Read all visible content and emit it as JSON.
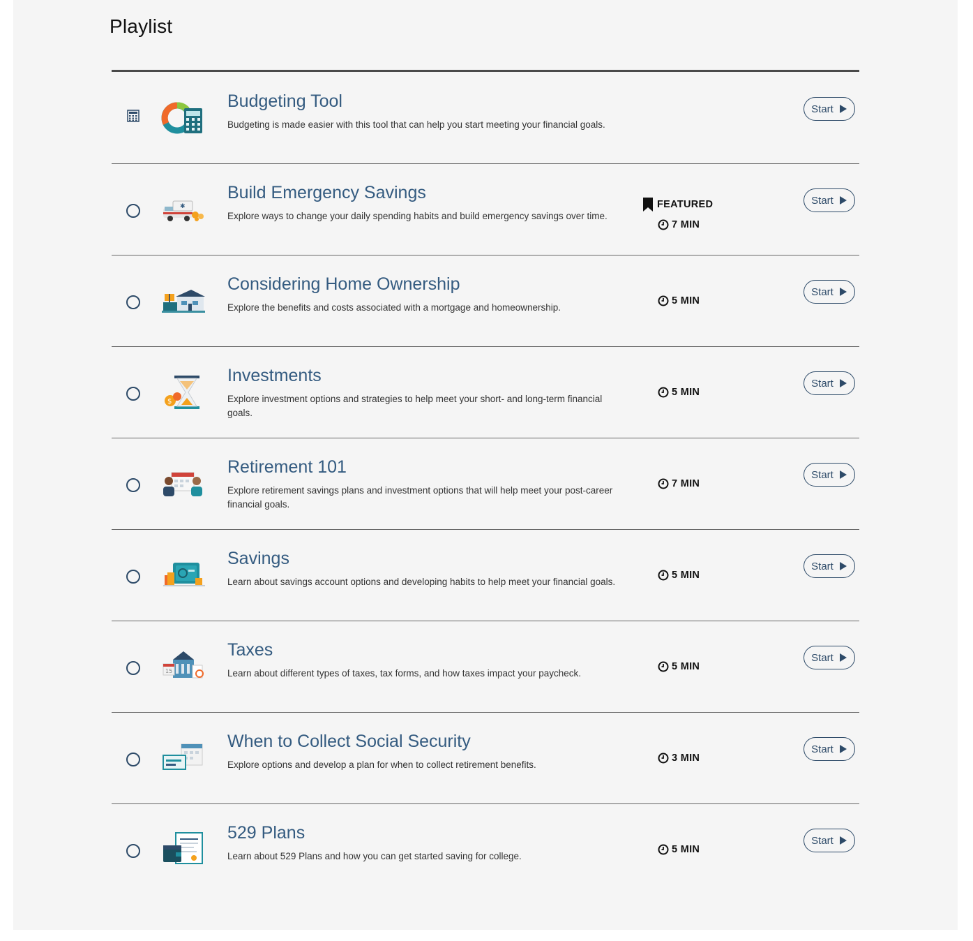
{
  "page": {
    "title": "Playlist"
  },
  "featured_label": "FEATURED",
  "items": [
    {
      "title": "Budgeting Tool",
      "description": "Budgeting is made easier with this tool that can help you start meeting your financial goals.",
      "duration": "",
      "featured": false,
      "status_icon": "calculator-icon",
      "thumbnail": "budget-chart-calculator-illustration",
      "start_label": "Start"
    },
    {
      "title": "Build Emergency Savings",
      "description": "Explore ways to change your daily spending habits and build emergency savings over time.",
      "duration": "7 MIN",
      "featured": true,
      "status_icon": "circle-icon",
      "thumbnail": "ambulance-coins-illustration",
      "start_label": "Start"
    },
    {
      "title": "Considering Home Ownership",
      "description": "Explore the benefits and costs associated with a mortgage and homeownership.",
      "duration": "5 MIN",
      "featured": false,
      "status_icon": "circle-icon",
      "thumbnail": "house-sale-illustration",
      "start_label": "Start"
    },
    {
      "title": "Investments",
      "description": "Explore investment options and strategies to help meet your short- and long-term financial goals.",
      "duration": "5 MIN",
      "featured": false,
      "status_icon": "circle-icon",
      "thumbnail": "hourglass-coins-illustration",
      "start_label": "Start"
    },
    {
      "title": "Retirement 101",
      "description": "Explore retirement savings plans and investment options that will help meet your post-career financial goals.",
      "duration": "7 MIN",
      "featured": false,
      "status_icon": "circle-icon",
      "thumbnail": "couple-calendar-illustration",
      "start_label": "Start"
    },
    {
      "title": "Savings",
      "description": "Learn about savings account options and developing habits to help meet your financial goals.",
      "duration": "5 MIN",
      "featured": false,
      "status_icon": "circle-icon",
      "thumbnail": "safe-coins-illustration",
      "start_label": "Start"
    },
    {
      "title": "Taxes",
      "description": "Learn about different types of taxes, tax forms, and how taxes impact your paycheck.",
      "duration": "5 MIN",
      "featured": false,
      "status_icon": "circle-icon",
      "thumbnail": "building-calendar-illustration",
      "start_label": "Start"
    },
    {
      "title": "When to Collect Social Security",
      "description": "Explore options and develop a plan for when to collect retirement benefits.",
      "duration": "3 MIN",
      "featured": false,
      "status_icon": "circle-icon",
      "thumbnail": "social-security-card-calendar-illustration",
      "start_label": "Start"
    },
    {
      "title": "529 Plans",
      "description": "Learn about 529 Plans and how you can get started saving for college.",
      "duration": "5 MIN",
      "featured": false,
      "status_icon": "circle-icon",
      "thumbnail": "diploma-wallet-illustration",
      "start_label": "Start"
    }
  ],
  "colors": {
    "accent": "#345b80",
    "teal": "#1f8f9e",
    "orange": "#f4a11d",
    "background": "#f5f5f5"
  }
}
